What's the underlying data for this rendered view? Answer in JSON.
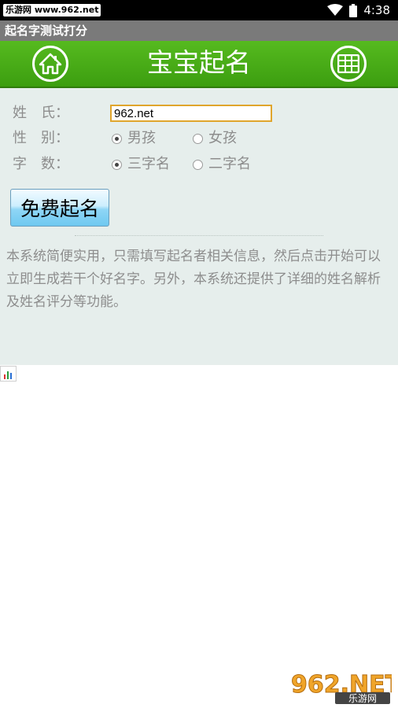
{
  "status_bar": {
    "badge_text": "乐游网 www.962.net",
    "time": "4:38"
  },
  "title_bar": {
    "title": "起名字测试打分"
  },
  "header": {
    "title": "宝宝起名",
    "home_icon": "home-icon",
    "menu_icon": "grid-icon",
    "color": "#4cae18"
  },
  "form": {
    "surname_label": "姓　氏：",
    "surname_value": "962.net",
    "gender_label": "性　别：",
    "gender_options": [
      {
        "label": "男孩",
        "checked": true
      },
      {
        "label": "女孩",
        "checked": false
      }
    ],
    "count_label": "字　数：",
    "count_options": [
      {
        "label": "三字名",
        "checked": true
      },
      {
        "label": "二字名",
        "checked": false
      }
    ],
    "submit_label": "免费起名"
  },
  "description": "本系统简便实用，只需填写起名者相关信息，然后点击开始可以立即生成若干个好名字。另外，本系统还提供了详细的姓名解析及姓名评分等功能。",
  "watermark": {
    "logo": "962.NET",
    "sub": "乐游网"
  }
}
